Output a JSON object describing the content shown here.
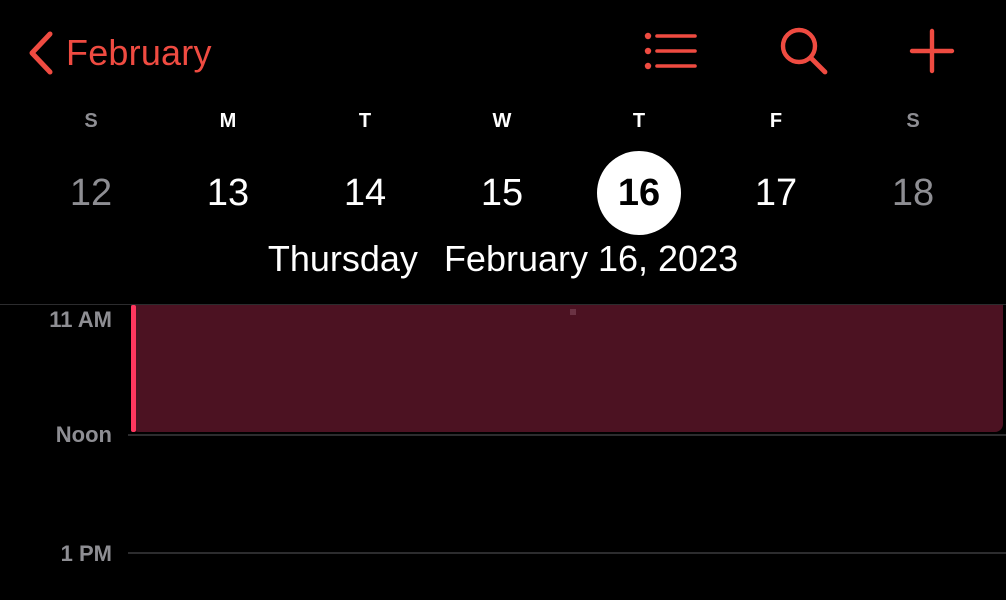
{
  "header": {
    "back_label": "February",
    "accent_color": "#ef4b41",
    "icons": [
      "chevron-left-icon",
      "list-icon",
      "search-icon",
      "plus-icon"
    ]
  },
  "week": {
    "weekdays": [
      "S",
      "M",
      "T",
      "W",
      "T",
      "F",
      "S"
    ],
    "dates": [
      "12",
      "13",
      "14",
      "15",
      "16",
      "17",
      "18"
    ],
    "selected_date": "16"
  },
  "selected_day": {
    "weekday": "Thursday",
    "date": "February 16, 2023"
  },
  "timeline": {
    "hours": [
      "11 AM",
      "Noon",
      "1 PM"
    ]
  },
  "event": {
    "color": "#ff375f"
  }
}
